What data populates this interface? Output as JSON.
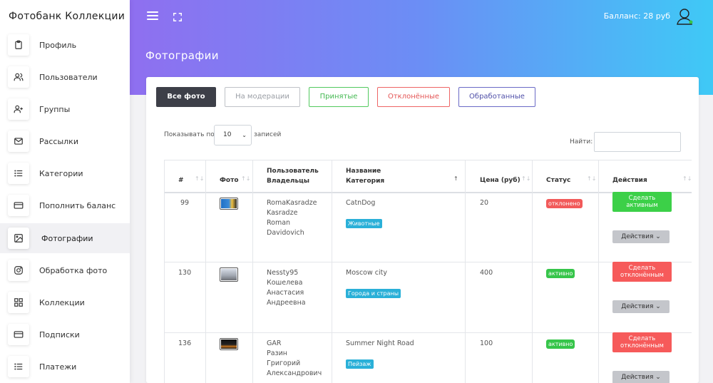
{
  "brand": "Фотобанк Коллекции",
  "sidebar": {
    "items": [
      {
        "label": "Профиль",
        "icon": "clipboard-icon"
      },
      {
        "label": "Пользователи",
        "icon": "users-icon"
      },
      {
        "label": "Группы",
        "icon": "user-plus-icon"
      },
      {
        "label": "Рассылки",
        "icon": "mail-icon"
      },
      {
        "label": "Категории",
        "icon": "list-icon"
      },
      {
        "label": "Пополнить баланс",
        "icon": "credit-card-icon"
      },
      {
        "label": "Фотографии",
        "icon": "image-icon"
      },
      {
        "label": "Обработка фото",
        "icon": "instagram-icon"
      },
      {
        "label": "Коллекции",
        "icon": "grid-icon"
      },
      {
        "label": "Подписки",
        "icon": "credit-card-icon"
      },
      {
        "label": "Платежи",
        "icon": "list-icon"
      }
    ]
  },
  "header": {
    "balance": "Балланс: 28 руб",
    "page_title": "Фотографии"
  },
  "filters": {
    "all": "Все фото",
    "moderation": "На модерации",
    "accepted": "Принятые",
    "rejected": "Отклонённые",
    "processed": "Обработанные"
  },
  "controls": {
    "show_label": "Показывать по",
    "per_page": "10",
    "records_label": "записей",
    "search_label": "Найти:"
  },
  "table": {
    "headers": {
      "id": "#",
      "photo": "Фото",
      "owner_line1": "Пользователь",
      "owner_line2": "Владельцы",
      "name_line1": "Название",
      "name_line2": "Категория",
      "price": "Цена (руб)",
      "status": "Статус",
      "actions": "Действия"
    },
    "rows": [
      {
        "id": "99",
        "owner": [
          "RomaKasradze",
          "Kasradze",
          "Roman",
          "Davidovich"
        ],
        "title": "CatnDog",
        "category": "Животные",
        "price": "20",
        "status": "отклонено",
        "action": "Сделать активным",
        "dropdown": "Действия"
      },
      {
        "id": "130",
        "owner": [
          "Nessty95",
          "Кошелева",
          "Анастасия",
          "Андреевна"
        ],
        "title": "Moscow city",
        "category": "Города и страны",
        "price": "400",
        "status": "активно",
        "action": "Сделать отклонённым",
        "dropdown": "Действия"
      },
      {
        "id": "136",
        "owner": [
          "GAR",
          "Разин",
          "Григорий",
          "Александрович"
        ],
        "title": "Summer Night Road",
        "category": "Пейзаж",
        "price": "100",
        "status": "активно",
        "action": "Сделать отклонённым",
        "dropdown": "Действия"
      }
    ]
  },
  "colors": {
    "gradient_start": "#8f6ff0",
    "gradient_end": "#3fc9f6",
    "tag_blue": "#2ab0d8",
    "status_red": "#f25a5a",
    "status_green": "#36c54a",
    "btn_green": "#3cd048",
    "btn_red": "#f65a5a",
    "btn_dark": "#3d3f48",
    "filter_green": "#52c95e",
    "filter_red": "#ee6565",
    "filter_purple": "#6a6ac6"
  }
}
